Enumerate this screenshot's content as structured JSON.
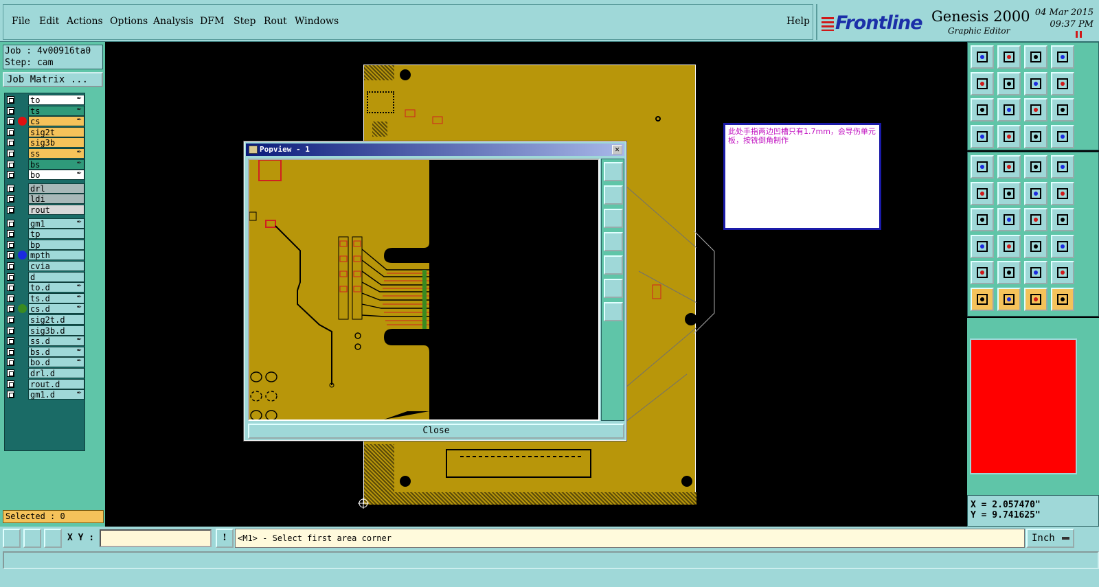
{
  "menubar": {
    "items": [
      "File",
      "Edit",
      "Actions",
      "Options",
      "Analysis",
      "DFM",
      "Step",
      "Rout",
      "Windows"
    ],
    "help": "Help"
  },
  "brand": {
    "logo": "Frontline",
    "title": "Genesis 2000",
    "subtitle": "Graphic Editor",
    "date": "04 Mar 2015",
    "time": "09:37 PM"
  },
  "job": {
    "job_line": "Job : 4v00916ta0",
    "step_line": "Step: cam",
    "matrix_button": "Job Matrix ..."
  },
  "layers": [
    {
      "name": "to",
      "color": "#ffffff",
      "dot": "",
      "pen": "✒"
    },
    {
      "name": "ts",
      "color": "#2f9a7a",
      "dot": "",
      "pen": "✒"
    },
    {
      "name": "cs",
      "color": "#f5c25a",
      "dot": "#e01010",
      "pen": "✒"
    },
    {
      "name": "sig2t",
      "color": "#f5c25a",
      "dot": "",
      "pen": ""
    },
    {
      "name": "sig3b",
      "color": "#f5c25a",
      "dot": "",
      "pen": ""
    },
    {
      "name": "ss",
      "color": "#f5c25a",
      "dot": "",
      "pen": "✒"
    },
    {
      "name": "bs",
      "color": "#2f9a7a",
      "dot": "",
      "pen": "✒"
    },
    {
      "name": "bo",
      "color": "#ffffff",
      "dot": "",
      "pen": "✒"
    },
    {
      "name": "drl",
      "color": "#a8b8b8",
      "dot": "",
      "pen": ""
    },
    {
      "name": "ldi",
      "color": "#a8b8b8",
      "dot": "",
      "pen": ""
    },
    {
      "name": "rout",
      "color": "#d8d8d8",
      "dot": "",
      "pen": ""
    },
    {
      "name": "gm1",
      "color": "#9fd8d8",
      "dot": "",
      "pen": "✒"
    },
    {
      "name": "tp",
      "color": "#9fd8d8",
      "dot": "",
      "pen": ""
    },
    {
      "name": "bp",
      "color": "#9fd8d8",
      "dot": "",
      "pen": ""
    },
    {
      "name": "mpth",
      "color": "#9fd8d8",
      "dot": "#1a2ae0",
      "pen": ""
    },
    {
      "name": "cvia",
      "color": "#9fd8d8",
      "dot": "",
      "pen": ""
    },
    {
      "name": "d",
      "color": "#9fd8d8",
      "dot": "",
      "pen": ""
    },
    {
      "name": "to.d",
      "color": "#9fd8d8",
      "dot": "",
      "pen": "✒"
    },
    {
      "name": "ts.d",
      "color": "#9fd8d8",
      "dot": "",
      "pen": "✒"
    },
    {
      "name": "cs.d",
      "color": "#9fd8d8",
      "dot": "#3a8a20",
      "pen": "✒"
    },
    {
      "name": "sig2t.d",
      "color": "#9fd8d8",
      "dot": "",
      "pen": ""
    },
    {
      "name": "sig3b.d",
      "color": "#9fd8d8",
      "dot": "",
      "pen": ""
    },
    {
      "name": "ss.d",
      "color": "#9fd8d8",
      "dot": "",
      "pen": "✒"
    },
    {
      "name": "bs.d",
      "color": "#9fd8d8",
      "dot": "",
      "pen": "✒"
    },
    {
      "name": "bo.d",
      "color": "#9fd8d8",
      "dot": "",
      "pen": "✒"
    },
    {
      "name": "drl.d",
      "color": "#9fd8d8",
      "dot": "",
      "pen": ""
    },
    {
      "name": "rout.d",
      "color": "#9fd8d8",
      "dot": "",
      "pen": ""
    },
    {
      "name": "gm1.d",
      "color": "#9fd8d8",
      "dot": "",
      "pen": "✒"
    }
  ],
  "selected": "Selected : 0",
  "note": "此处手指两边凹槽只有1.7mm，会导伤单元板，按铣倒角制作",
  "popview": {
    "title": "Popview - 1",
    "close_button": "Close"
  },
  "coords": {
    "x": "X = 2.057470\"",
    "y": "Y = 9.741625\""
  },
  "bottom": {
    "xy_label": "X Y :",
    "xy_value": "",
    "prompt": "<M1> - Select first area corner",
    "units": "Inch"
  },
  "colors": {
    "panel": "#9fd8d8",
    "panel_dark": "#5fc5a8",
    "copper": "#b8960a",
    "note_border": "#1a1aa8",
    "note_text": "#c010c0",
    "minimap": "#ff0000"
  }
}
